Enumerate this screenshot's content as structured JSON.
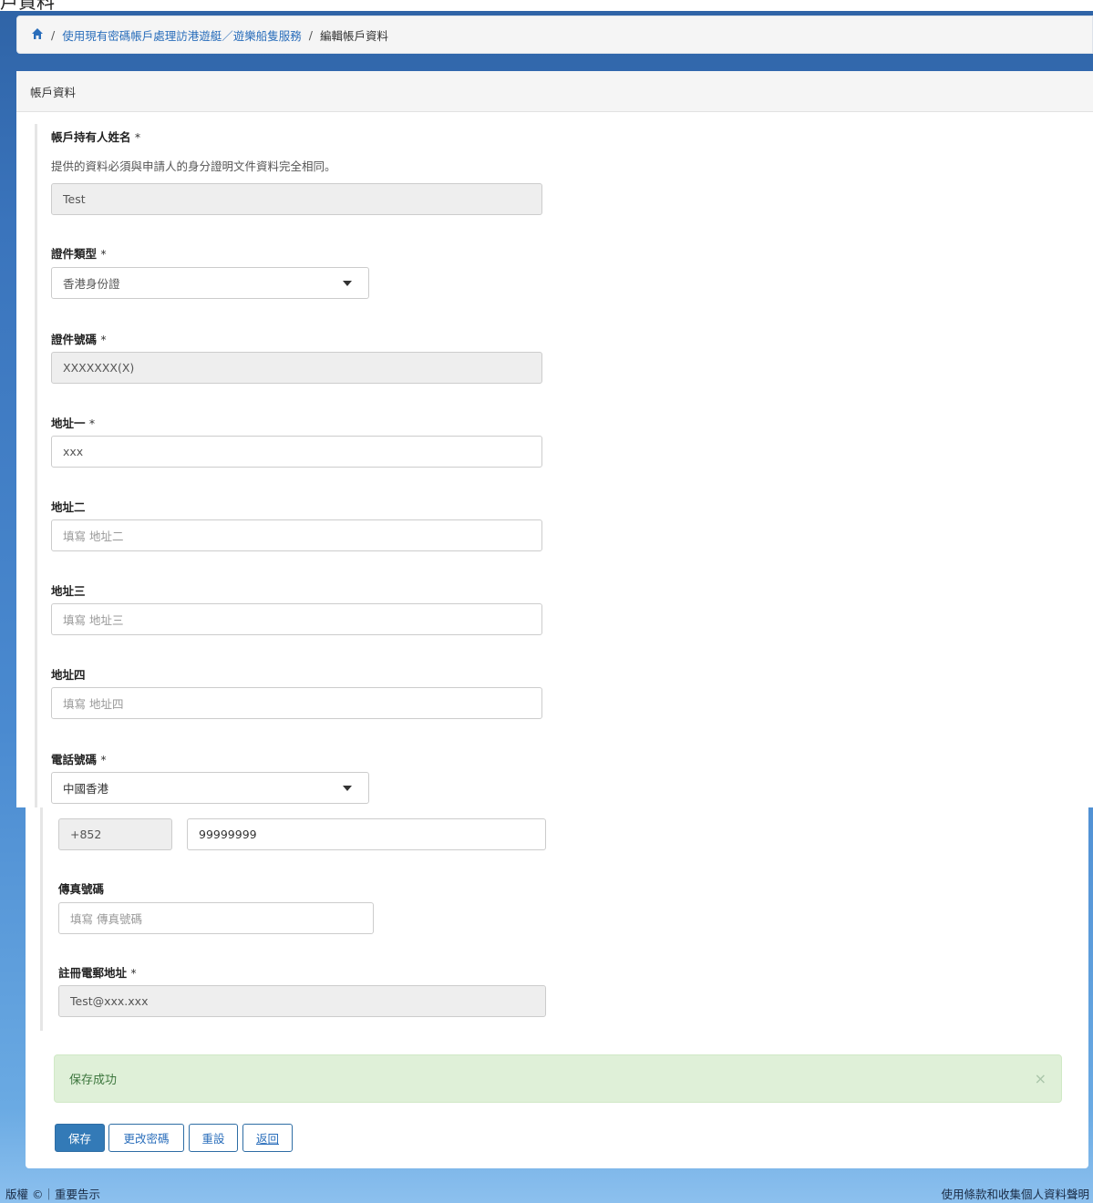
{
  "top_cut_text": "戶資料",
  "breadcrumb": {
    "service": "使用現有密碼帳戶處理訪港遊艇／遊樂船隻服務",
    "current": "編輯帳戶資料"
  },
  "panel": {
    "title": "帳戶資料"
  },
  "form": {
    "required_mark": "*",
    "holder_name": {
      "label": "帳戶持有人姓名",
      "help": "提供的資料必須與申請人的身分證明文件資料完全相同。",
      "value": "Test"
    },
    "doc_type": {
      "label": "證件類型",
      "value": "香港身份證"
    },
    "doc_number": {
      "label": "證件號碼",
      "value": "XXXXXXX(X)"
    },
    "address1": {
      "label": "地址一",
      "value": "xxx"
    },
    "address2": {
      "label": "地址二",
      "placeholder": "填寫 地址二"
    },
    "address3": {
      "label": "地址三",
      "placeholder": "填寫 地址三"
    },
    "address4": {
      "label": "地址四",
      "placeholder": "填寫 地址四"
    },
    "phone": {
      "label": "電話號碼",
      "region": "中國香港",
      "code": "+852",
      "number": "99999999"
    },
    "fax": {
      "label": "傳真號碼",
      "placeholder": "填寫 傳真號碼"
    },
    "email": {
      "label": "註冊電郵地址",
      "value": "Test@xxx.xxx"
    }
  },
  "alert": {
    "message": "保存成功",
    "close": "×"
  },
  "buttons": {
    "save": "保存",
    "change_password": "更改密碼",
    "reset": "重設",
    "back": "返回"
  },
  "footer": {
    "left": "版權 ©｜重要告示",
    "right": "使用條款和收集個人資料聲明"
  },
  "icons": {
    "home": "home-icon",
    "caret": "caret-down-icon",
    "close": "close-icon"
  },
  "colors": {
    "brand_blue": "#337ab7",
    "link": "#2a6ebb",
    "success_bg": "#dff0d8",
    "success_text": "#3c763d"
  }
}
